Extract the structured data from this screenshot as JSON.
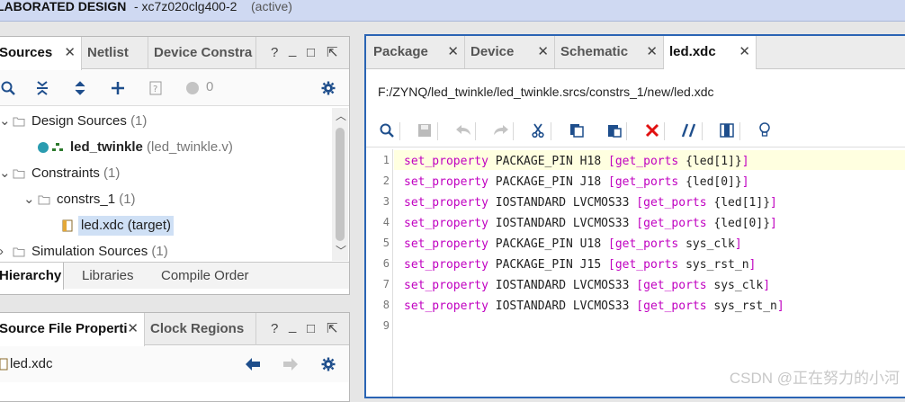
{
  "title": {
    "project": "LABORATED DESIGN",
    "device": "- xc7z020clg400-2",
    "status": "(active)"
  },
  "colors": {
    "accent": "#2a64b4",
    "keyword": "#c000c0",
    "current_line": "#ffffe0",
    "delete_red": "#e11111"
  },
  "left_top": {
    "tabs": [
      {
        "label": "Sources",
        "closable": true,
        "active": true
      },
      {
        "label": "Netlist",
        "closable": false,
        "active": false
      },
      {
        "label": "Device Constra",
        "closable": false,
        "active": false
      }
    ],
    "window_controls": [
      "?",
      "_",
      "□",
      "⇱"
    ],
    "toolbar": {
      "icons": [
        "search-icon",
        "collapse-all-icon",
        "expand-all-icon",
        "add-icon",
        "info-icon",
        "status-dot-icon",
        "settings-icon"
      ],
      "count": "0"
    },
    "tree": [
      {
        "label": "Design Sources",
        "count": "(1)"
      },
      {
        "label": "led_twinkle",
        "count": "(led_twinkle.v)"
      },
      {
        "label": "Constraints",
        "count": "(1)"
      },
      {
        "label": "constrs_1",
        "count": "(1)"
      },
      {
        "label": "led.xdc (target)"
      },
      {
        "label": "Simulation Sources",
        "count": "(1)"
      }
    ],
    "bottom_tabs": [
      "Hierarchy",
      "Libraries",
      "Compile Order"
    ]
  },
  "left_bottom": {
    "tabs": [
      {
        "label": "Source File Properti",
        "closable": true,
        "active": true
      },
      {
        "label": "Clock Regions",
        "closable": false,
        "active": false
      }
    ],
    "window_controls": [
      "?",
      "_",
      "□",
      "⇱"
    ],
    "file": "led.xdc"
  },
  "editor": {
    "tabs": [
      {
        "label": "Package",
        "closable": true,
        "active": false
      },
      {
        "label": "Device",
        "closable": true,
        "active": false
      },
      {
        "label": "Schematic",
        "closable": true,
        "active": false
      },
      {
        "label": "led.xdc",
        "closable": true,
        "active": true
      }
    ],
    "path": "F:/ZYNQ/led_twinkle/led_twinkle.srcs/constrs_1/new/led.xdc",
    "lines": [
      {
        "n": "1",
        "kw": "set_property",
        "prop": " PACKAGE_PIN H18 ",
        "open": "[",
        "cmd": "get_ports",
        "arg": " {led[1]}",
        "close": "]"
      },
      {
        "n": "2",
        "kw": "set_property",
        "prop": " PACKAGE_PIN J18 ",
        "open": "[",
        "cmd": "get_ports",
        "arg": " {led[0]}",
        "close": "]"
      },
      {
        "n": "3",
        "kw": "set_property",
        "prop": " IOSTANDARD LVCMOS33 ",
        "open": "[",
        "cmd": "get_ports",
        "arg": " {led[1]}",
        "close": "]"
      },
      {
        "n": "4",
        "kw": "set_property",
        "prop": " IOSTANDARD LVCMOS33 ",
        "open": "[",
        "cmd": "get_ports",
        "arg": " {led[0]}",
        "close": "]"
      },
      {
        "n": "5",
        "kw": "set_property",
        "prop": " PACKAGE_PIN U18 ",
        "open": "[",
        "cmd": "get_ports",
        "arg": " sys_clk",
        "close": "]"
      },
      {
        "n": "6",
        "kw": "set_property",
        "prop": " PACKAGE_PIN J15 ",
        "open": "[",
        "cmd": "get_ports",
        "arg": " sys_rst_n",
        "close": "]"
      },
      {
        "n": "7",
        "kw": "set_property",
        "prop": " IOSTANDARD LVCMOS33 ",
        "open": "[",
        "cmd": "get_ports",
        "arg": " sys_clk",
        "close": "]"
      },
      {
        "n": "8",
        "kw": "set_property",
        "prop": " IOSTANDARD LVCMOS33 ",
        "open": "[",
        "cmd": "get_ports",
        "arg": " sys_rst_n",
        "close": "]"
      },
      {
        "n": "9",
        "kw": "",
        "prop": "",
        "open": "",
        "cmd": "",
        "arg": "",
        "close": ""
      }
    ]
  },
  "watermark": "CSDN @正在努力的小河"
}
